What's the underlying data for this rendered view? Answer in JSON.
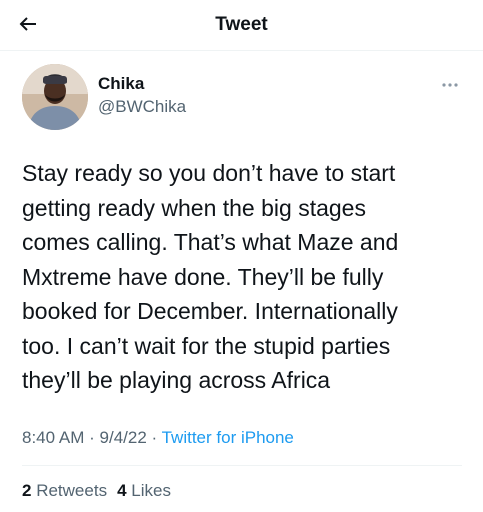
{
  "header": {
    "title": "Tweet"
  },
  "tweet": {
    "author_name": "Chika",
    "author_handle": "@BWChika",
    "text": "Stay ready so you don’t have to start\ngetting ready when the big stages\ncomes calling. That’s what Maze and\nMxtreme have done. They’ll be fully\nbooked for December. Internationally\ntoo. I can’t wait for the stupid parties\nthey’ll be playing across Africa",
    "time": "8:40 AM",
    "separator": "·",
    "date": "9/4/22",
    "source": "Twitter for iPhone",
    "retweets_count": "2",
    "retweets_label": "Retweets",
    "likes_count": "4",
    "likes_label": "Likes"
  },
  "icons": {
    "back": "arrow-left-icon",
    "more": "more-horizontal-icon"
  },
  "colors": {
    "text": "#0f1419",
    "secondary": "#536471",
    "link": "#1d9bf0",
    "divider": "#eff3f4"
  }
}
